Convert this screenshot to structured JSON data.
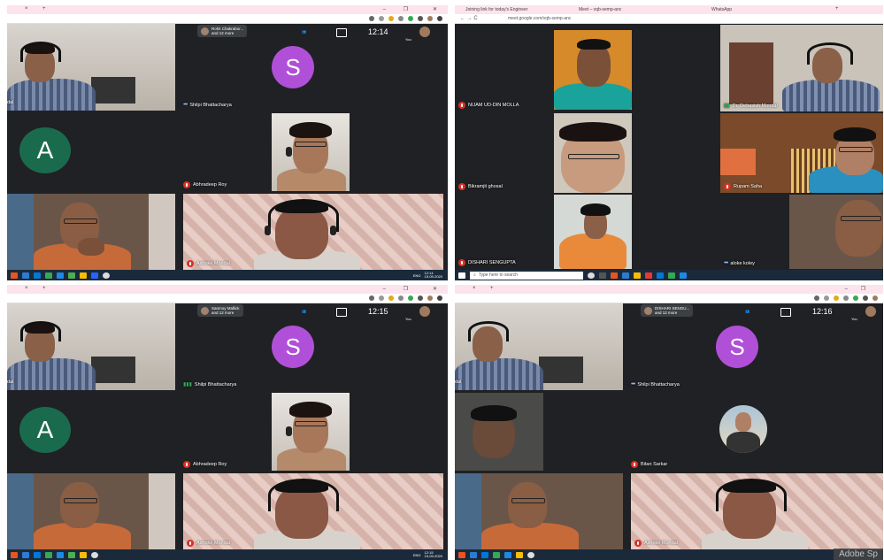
{
  "panels": {
    "tl": {
      "tab_close": "×",
      "tab_add": "+",
      "caller": {
        "line1": "Rohit Chakrabor...",
        "line2": "and 12 more"
      },
      "clock": "12:14",
      "you": "You",
      "tiles": {
        "shilpi": "Shilpi Bhattacharya",
        "abhradeep": "Abhradeep Roy",
        "ashoke": "Ashoke Mondal",
        "cropped_name": "dal"
      },
      "avatar_s": "S",
      "avatar_a": "A",
      "taskbar": {
        "lang": "ENG",
        "time": "12:14",
        "date": "15-09-2020"
      }
    },
    "tr": {
      "tabs": [
        "Joining link for today's Engineer",
        "Meet – vqb-semp-anc",
        "WhatsApp"
      ],
      "tab_add": "+",
      "url": "meet.google.com/vqb-semp-anc",
      "tiles": {
        "nijam": "NIJAM UD-DIN MOLLA",
        "debasish": "Dr. Debasish Mondal",
        "bikramjit": "Bikramjit ghosal",
        "rupam": "Rupam Saha",
        "dishari": "DISHARI SENGUPTA",
        "aloke": "aloke koley"
      },
      "taskbar": {
        "search_placeholder": "Type here to search"
      }
    },
    "bl": {
      "tab_close": "×",
      "tab_add": "+",
      "caller": {
        "line1": "Sanmoy Mallick",
        "line2": "and 12 more"
      },
      "clock": "12:15",
      "you": "You",
      "tiles": {
        "shilpi": "Shilpi Bhattacharya",
        "abhradeep": "Abhradeep Roy",
        "ashoke": "Ashoke Mondal",
        "cropped_name": "dal"
      },
      "avatar_s": "S",
      "avatar_a": "A",
      "taskbar": {
        "lang": "ENG",
        "time": "12:15",
        "date": "15-09-2020"
      }
    },
    "br": {
      "tab_close": "×",
      "tab_add": "+",
      "caller": {
        "line1": "DISHARI SENGU...",
        "line2": "and 12 more"
      },
      "clock": "12:16",
      "you": "You",
      "tiles": {
        "shilpi": "Shilpi Bhattacharya",
        "bitan": "Bitan Sarkar",
        "ashoke": "Ashoke Mondal",
        "cropped_name": "dal"
      },
      "avatar_s": "S",
      "watermark": "Adobe Sp"
    }
  },
  "colors": {
    "meet_bg": "#202124",
    "avatar_s": "#b050d8",
    "avatar_a": "#1a6b4d",
    "mic_off": "#d93025",
    "chrome_tab_bar": "#fde4ec",
    "taskbar": "#1b2a3b"
  }
}
